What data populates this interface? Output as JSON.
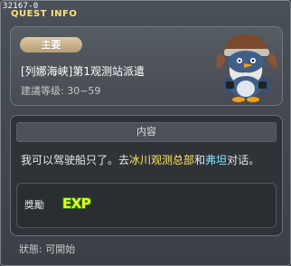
{
  "window": {
    "id": "32167-0",
    "title": "QUEST INFO"
  },
  "header": {
    "type_badge": "主要",
    "quest_name": "[列娜海峡]第1观测站派遣",
    "level_label": "建議等级: 30~59"
  },
  "content": {
    "heading": "内容",
    "text_before": "我可以驾驶船只了。去",
    "location": "冰川观测总部",
    "text_and": "和",
    "npc_name": "弗坦",
    "text_after": "对话。"
  },
  "reward": {
    "label": "獎勵",
    "exp_text": "EXP"
  },
  "status": {
    "text": "狀態: 可開始"
  },
  "colors": {
    "title": "#ffe27a",
    "badge": "#c9b089",
    "highlight_location": "#ffe65a",
    "highlight_npc": "#7fe8ff",
    "exp": "#e6ff1a"
  },
  "icons": {
    "npc": "penguin-npc-icon",
    "exp": "exp-icon"
  }
}
